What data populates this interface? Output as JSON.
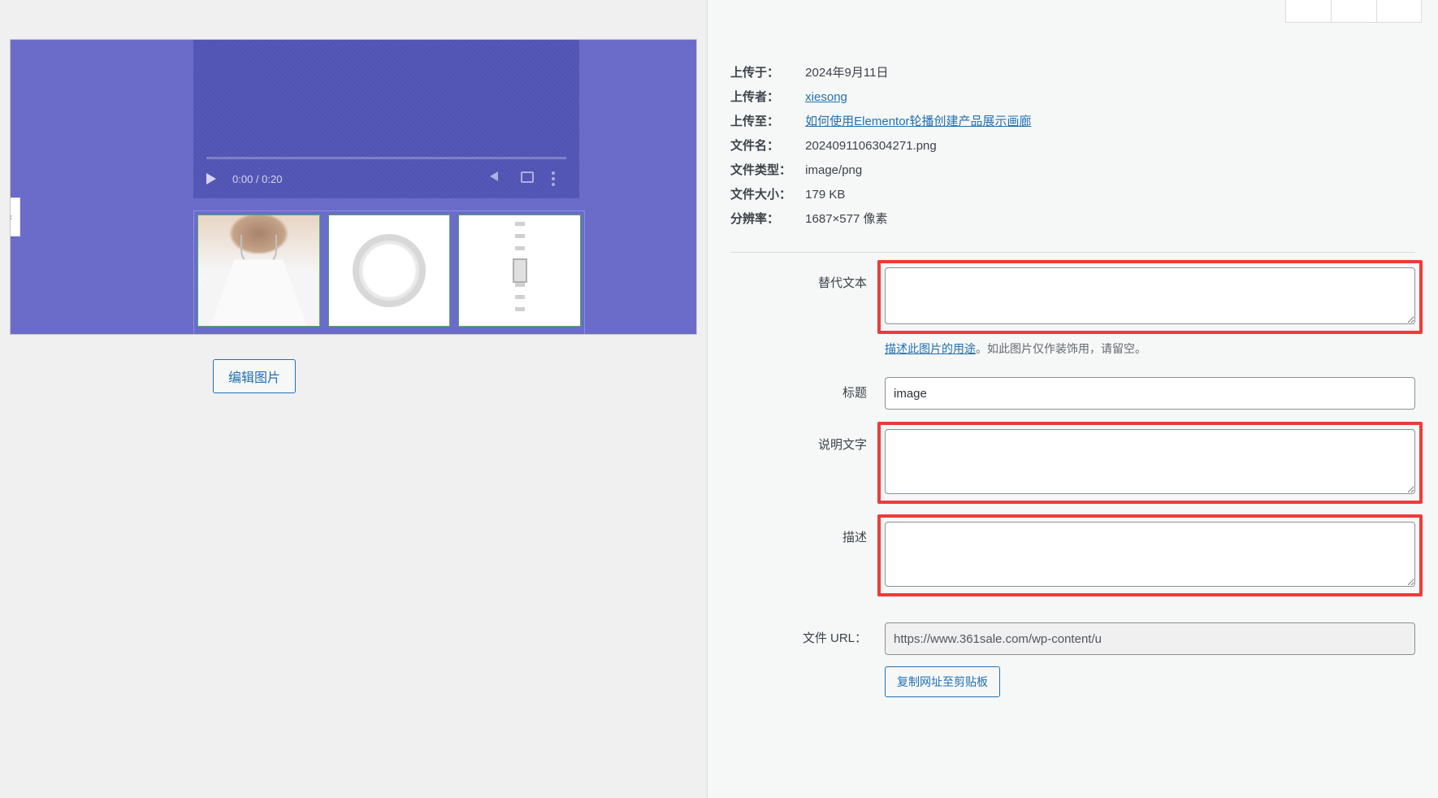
{
  "preview": {
    "video_time": "0:00 / 0:20",
    "dots_active_index": 3
  },
  "edit_image_label": "编辑图片",
  "meta": {
    "uploaded_on_label": "上传于：",
    "uploaded_on_value": "2024年9月11日",
    "uploaded_by_label": "上传者：",
    "uploaded_by_value": "xiesong",
    "uploaded_to_label": "上传至：",
    "uploaded_to_value": "如何使用Elementor轮播创建产品展示画廊",
    "filename_label": "文件名：",
    "filename_value": "2024091106304271.png",
    "filetype_label": "文件类型：",
    "filetype_value": "image/png",
    "filesize_label": "文件大小：",
    "filesize_value": "179 KB",
    "dimensions_label": "分辨率：",
    "dimensions_value": "1687×577 像素"
  },
  "form": {
    "alt_label": "替代文本",
    "alt_value": "",
    "alt_help_link": "描述此图片的用途",
    "alt_help_rest": "。如此图片仅作装饰用，请留空。",
    "title_label": "标题",
    "title_value": "image",
    "caption_label": "说明文字",
    "caption_value": "",
    "description_label": "描述",
    "description_value": "",
    "fileurl_label": "文件 URL：",
    "fileurl_value": "https://www.361sale.com/wp-content/u",
    "copy_url_label": "复制网址至剪贴板"
  }
}
